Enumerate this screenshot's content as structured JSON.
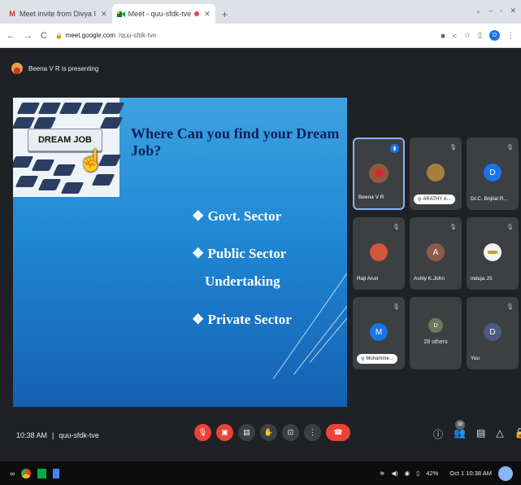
{
  "browser": {
    "tabs": [
      {
        "label": "Meet invite from Divya I",
        "icon": "gmail-icon"
      },
      {
        "label": "Meet - quu-sfdk-tve",
        "icon": "meet-icon",
        "active": true
      }
    ],
    "new_tab": "+",
    "url_host": "meet.google.com",
    "url_path": "/quu-sfdk-tve",
    "profile_initial": "D"
  },
  "meet": {
    "presenting_text": "Beena V R is presenting",
    "slide": {
      "title": "Where Can you find your Dream Job?",
      "button_text": "DREAM JOB",
      "bullets": [
        "❖ Govt. Sector",
        "❖ Public Sector",
        "Undertaking",
        "❖ Private Sector"
      ]
    },
    "participants": [
      {
        "name": "Beena V R",
        "initial": "",
        "color": "#8e5a3c",
        "speaking": true
      },
      {
        "name": "ARATHY A...",
        "initial": "",
        "color": "#a5803d",
        "pill": true
      },
      {
        "name": "Dr.C. Brijilal R...",
        "initial": "D",
        "color": "#1a73e8"
      },
      {
        "name": "Raji Arun",
        "initial": "",
        "color": "#d2553d"
      },
      {
        "name": "Ashly K.John",
        "initial": "A",
        "color": "#8d5b4c"
      },
      {
        "name": "induja JS",
        "initial": "",
        "color": "#f1f3f4"
      },
      {
        "name": "Mohamme...",
        "initial": "M",
        "color": "#1a73e8",
        "pill": true
      },
      {
        "name": "28 others",
        "initial": "D",
        "color": "#6b7a5a"
      },
      {
        "name": "You",
        "initial": "D",
        "color": "#4a5a80"
      }
    ],
    "time": "10:38 AM",
    "separator": "|",
    "meeting_code": "quu-sfdk-tve",
    "people_count": "38"
  },
  "taskbar": {
    "battery": "42%",
    "datetime": "Oct 1 10:38 AM"
  }
}
